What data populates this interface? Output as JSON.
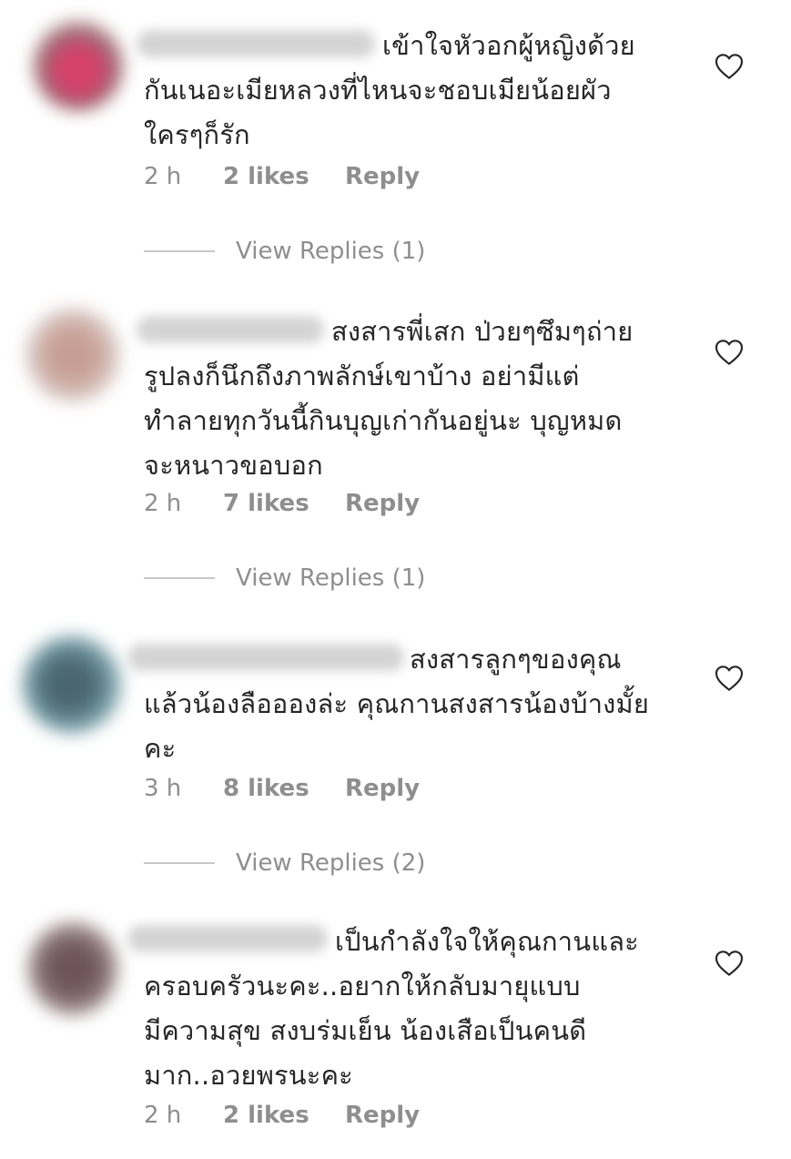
{
  "colors": {
    "text": "#262626",
    "secondary": "#8e8e8e",
    "rule": "#c7c7c7",
    "heart": "#262626"
  },
  "icons": {
    "like": "heart-outline-icon"
  },
  "comments": [
    {
      "avatar_color": "#c85a75",
      "lines": [
        "เข้าใจหัวอกผู้หญิงด้วย",
        "กันเนอะเมียหลวงที่ไหนจะชอบเมียน้อยผัว",
        "ใครๆก็รัก"
      ],
      "time": "2 h",
      "likes": "2 likes",
      "reply": "Reply",
      "view_replies": "View Replies (1)"
    },
    {
      "avatar_color": "#b89a90",
      "lines": [
        "สงสารพี่เสก ป่วยๆซึมๆถ่าย",
        "รูปลงก็นึกถึงภาพลักษ์เขาบ้าง อย่ามีแต่",
        "ทำลายทุกวันนี้กินบุญเก่ากันอยู่นะ บุญหมด",
        "จะหนาวขอบอก"
      ],
      "time": "2 h",
      "likes": "7 likes",
      "reply": "Reply",
      "view_replies": "View Replies (1)"
    },
    {
      "avatar_color": "#5d7f8c",
      "lines": [
        "สงสารลูกๆของคุณ",
        "แล้วน้องลืออองล่ะ คุณกานสงสารน้องบ้างมั้ย",
        "คะ"
      ],
      "time": "3 h",
      "likes": "8 likes",
      "reply": "Reply",
      "view_replies": "View Replies (2)"
    },
    {
      "avatar_color": "#7a6468",
      "lines": [
        "เป็นกำลังใจให้คุณกานและ",
        "ครอบครัวนะคะ..อยากให้กลับมายุแบบ",
        "มีความสุข สงบร่มเย็น น้องเสือเป็นคนดี",
        "มาก..อวยพรนะคะ"
      ],
      "time": "2 h",
      "likes": "2 likes",
      "reply": "Reply"
    }
  ]
}
